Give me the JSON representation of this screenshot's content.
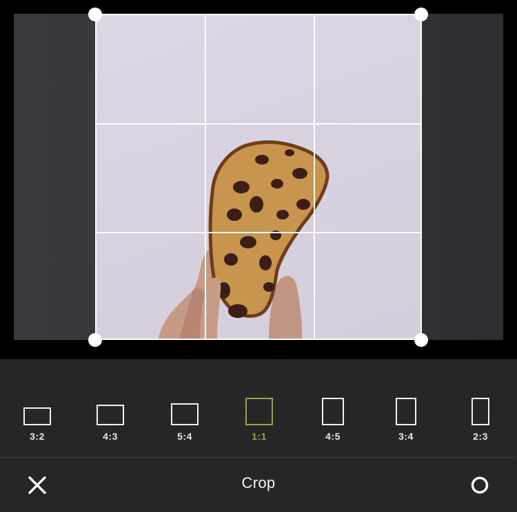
{
  "toolbar": {
    "title": "Crop",
    "cancel_icon": "close-icon",
    "confirm_icon": "circle-confirm-icon"
  },
  "aspect_ratios": [
    {
      "label": "3:2",
      "selected": false
    },
    {
      "label": "4:3",
      "selected": false
    },
    {
      "label": "5:4",
      "selected": false
    },
    {
      "label": "1:1",
      "selected": true
    },
    {
      "label": "4:5",
      "selected": false
    },
    {
      "label": "3:4",
      "selected": false
    },
    {
      "label": "2:3",
      "selected": false
    }
  ],
  "colors": {
    "selected_accent": "#a59f4c",
    "panel_background": "#262626",
    "crop_border": "#ffffff"
  }
}
